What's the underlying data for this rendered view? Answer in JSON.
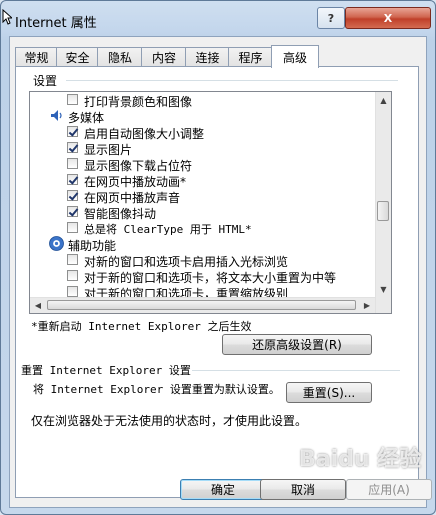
{
  "window": {
    "title": "Internet 属性",
    "help_label": "?",
    "close_label": "X"
  },
  "tabs": [
    {
      "label": "常规"
    },
    {
      "label": "安全"
    },
    {
      "label": "隐私"
    },
    {
      "label": "内容"
    },
    {
      "label": "连接"
    },
    {
      "label": "程序"
    },
    {
      "label": "高级",
      "active": true
    }
  ],
  "settings": {
    "label": "设置",
    "rows": [
      {
        "type": "check",
        "checked": false,
        "label": "打印背景颜色和图像"
      },
      {
        "type": "category",
        "icon": "multimedia-icon",
        "label": "多媒体"
      },
      {
        "type": "check",
        "checked": true,
        "label": "启用自动图像大小调整"
      },
      {
        "type": "check",
        "checked": true,
        "label": "显示图片"
      },
      {
        "type": "check",
        "checked": false,
        "label": "显示图像下载占位符"
      },
      {
        "type": "check",
        "checked": true,
        "label": "在网页中播放动画*"
      },
      {
        "type": "check",
        "checked": true,
        "label": "在网页中播放声音"
      },
      {
        "type": "check",
        "checked": true,
        "label": "智能图像抖动"
      },
      {
        "type": "check",
        "checked": false,
        "label": "总是将 ClearType 用于 HTML*"
      },
      {
        "type": "category",
        "icon": "accessibility-icon",
        "label": "辅助功能"
      },
      {
        "type": "check",
        "checked": false,
        "label": "对新的窗口和选项卡启用插入光标浏览"
      },
      {
        "type": "check",
        "checked": false,
        "label": "对于新的窗口和选项卡，将文本大小重置为中等"
      },
      {
        "type": "check",
        "checked": false,
        "label": "对于新的窗口和选项卡，重置缩放级别"
      }
    ]
  },
  "restart_note": "*重新启动 Internet Explorer 之后生效",
  "restore_button": "还原高级设置(R)",
  "reset_section": {
    "title": "重置 Internet Explorer 设置",
    "description": "将 Internet Explorer 设置重置为默认设置。",
    "button": "重置(S)...",
    "hint": "仅在浏览器处于无法使用的状态时，才使用此设置。"
  },
  "footer": {
    "ok": "确定",
    "cancel": "取消",
    "apply": "应用(A)"
  },
  "watermark": "Baidu 经验"
}
